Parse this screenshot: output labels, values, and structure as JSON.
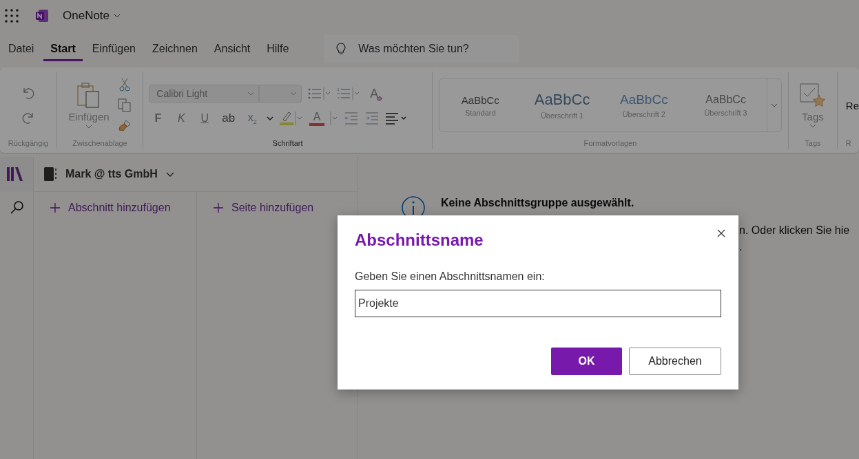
{
  "app_bar": {
    "app_name": "OneNote"
  },
  "menu_tabs": [
    {
      "label": "Datei",
      "selected": false
    },
    {
      "label": "Start",
      "selected": true
    },
    {
      "label": "Einfügen",
      "selected": false
    },
    {
      "label": "Zeichnen",
      "selected": false
    },
    {
      "label": "Ansicht",
      "selected": false
    },
    {
      "label": "Hilfe",
      "selected": false
    }
  ],
  "search": {
    "placeholder": "Was möchten Sie tun?"
  },
  "ribbon": {
    "undo_group": {
      "label": "Rückgängig"
    },
    "clipboard": {
      "paste_label": "Einfügen",
      "label": "Zwischenablage"
    },
    "font": {
      "font_name": "Calibri Light",
      "clear_glyph": "A",
      "format_buttons": [
        {
          "glyph": "F",
          "kind": "bold"
        },
        {
          "glyph": "K",
          "kind": "italic"
        },
        {
          "glyph": "U",
          "kind": "underline"
        },
        {
          "glyph": "ab",
          "kind": "strike"
        },
        {
          "glyph": "x$_{2}$",
          "kind": "subscript"
        }
      ],
      "color_glyph": "A",
      "label": "Schriftart"
    },
    "styles": {
      "items": [
        {
          "sample": "AaBbCc",
          "name": "Standard",
          "kind": "normal"
        },
        {
          "sample": "AaBbCc",
          "name": "Überschrift 1",
          "kind": "heading1"
        },
        {
          "sample": "AaBbCc",
          "name": "Überschrift 2",
          "kind": "heading2"
        },
        {
          "sample": "AaBbCc",
          "name": "Überschrift 3",
          "kind": "heading3"
        }
      ],
      "label": "Formatvorlagen"
    },
    "tags": {
      "button_label": "Tags",
      "label": "Tags"
    },
    "cut_group": {
      "button_label": "Re",
      "label": "R"
    }
  },
  "notebook": {
    "name": "Mark @ tts GmbH",
    "add_section": "Abschnitt hinzufügen",
    "add_page": "Seite hinzufügen"
  },
  "info": {
    "heading": "Keine Abschnittsgruppe ausgewählt.",
    "visible_lines": [
      "n. Oder klicken Sie hie",
      "."
    ]
  },
  "dialog": {
    "title": "Abschnittsname",
    "prompt": "Geben Sie einen Abschnittsnamen ein:",
    "value": "Projekte",
    "buttons": [
      {
        "label": "OK",
        "kind": "primary"
      },
      {
        "label": "Abbrechen",
        "kind": "secondary"
      }
    ]
  }
}
